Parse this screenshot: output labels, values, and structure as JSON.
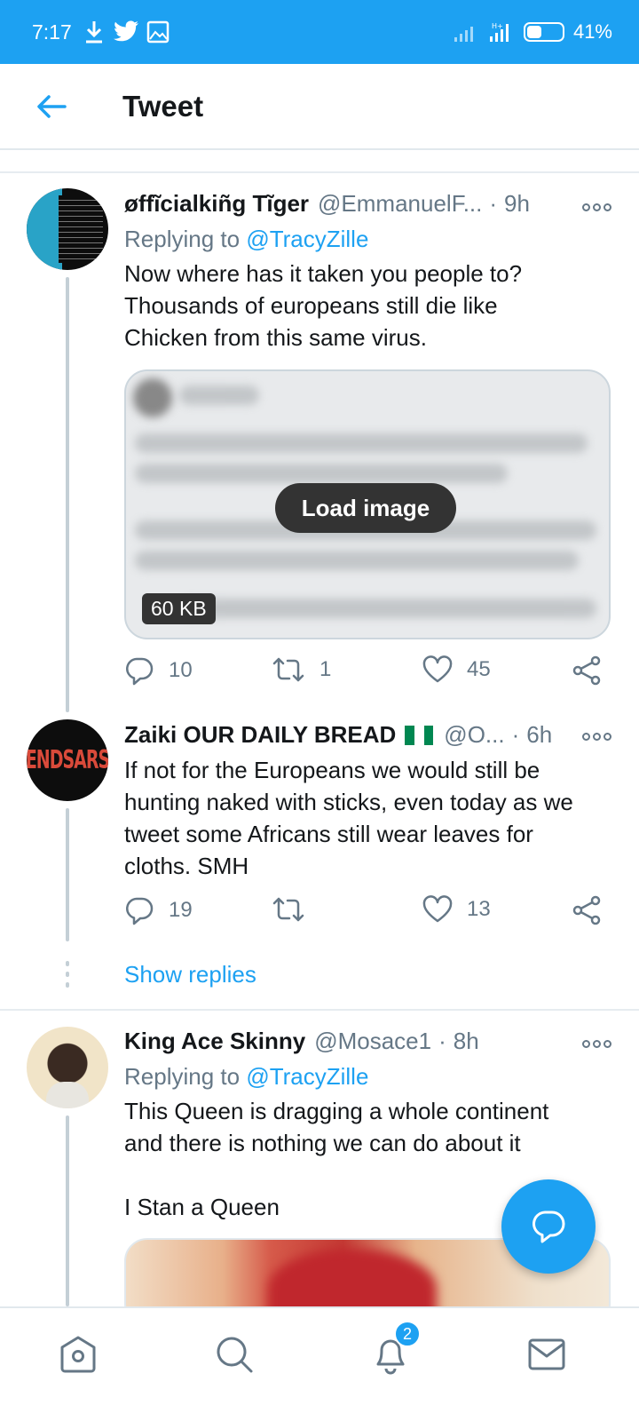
{
  "status_bar": {
    "time": "7:17",
    "battery": "41%",
    "battery_level": 0.41
  },
  "header": {
    "title": "Tweet"
  },
  "tweets": [
    {
      "name": "øffĩcialkiñg Tĩger",
      "handle": "@EmmanuelF...",
      "dot": "·",
      "time": "9h",
      "replying_prefix": "Replying to",
      "replying_to": "@TracyZille",
      "text": "Now where has it taken you people to?\nThousands of europeans still die like\nChicken from this same virus.",
      "media": {
        "load_label": "Load image",
        "size": "60 KB"
      },
      "replies": "10",
      "retweets": "1",
      "likes": "45"
    },
    {
      "name": "Zaiki OUR DAILY BREAD",
      "handle": "@O...",
      "dot": "·",
      "time": "6h",
      "avatar_text": "ENDSARS",
      "text": "If not for the Europeans we would still be\nhunting naked with sticks, even today as we\ntweet some Africans still wear leaves for\ncloths. SMH",
      "replies": "19",
      "retweets": "",
      "likes": "13",
      "show_replies": "Show replies"
    },
    {
      "name": "King Ace Skinny",
      "handle": "@Mosace1",
      "dot": "·",
      "time": "8h",
      "replying_prefix": "Replying to",
      "replying_to": "@TracyZille",
      "text": "This Queen is dragging a whole continent\nand there is nothing we can do about it\n\nI Stan a Queen"
    }
  ],
  "bottom_nav": {
    "notifications_badge": "2"
  },
  "colors": {
    "accent": "#1da1f2",
    "text": "#14171a",
    "muted": "#657786"
  }
}
